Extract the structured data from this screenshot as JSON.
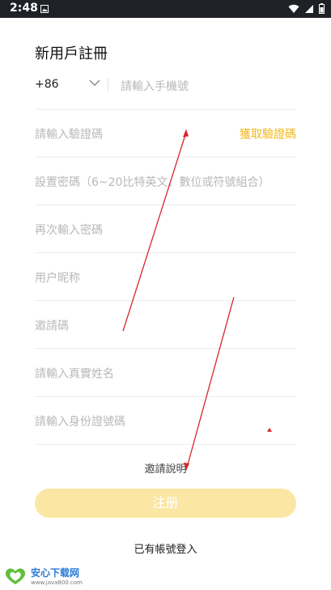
{
  "status_bar": {
    "time": "2:48",
    "icons": [
      "image-icon",
      "wifi-icon",
      "signal-icon",
      "battery-icon"
    ]
  },
  "title": "新用戶註冊",
  "phone": {
    "country_code": "+86",
    "placeholder": "請輸入手機號"
  },
  "verify": {
    "placeholder": "請輸入驗證碼",
    "get_code": "獲取驗證碼"
  },
  "fields": {
    "password": "設置密碼（6~20比特英文、數位或符號組合）",
    "confirm_password": "再次輸入密碼",
    "nickname": "用户昵称",
    "invite_code": "邀請碼",
    "real_name": "請輸入真實姓名",
    "id_number": "請輸入身份證號碼"
  },
  "invite_note": "邀請說明",
  "register_button": "注册",
  "login_link": "已有帳號登入",
  "watermark": {
    "name": "安心下载网",
    "url": "www.java800.com"
  },
  "colors": {
    "accent": "#f2b71d",
    "button": "#fbe7a3",
    "annotation": "#d9262b"
  }
}
